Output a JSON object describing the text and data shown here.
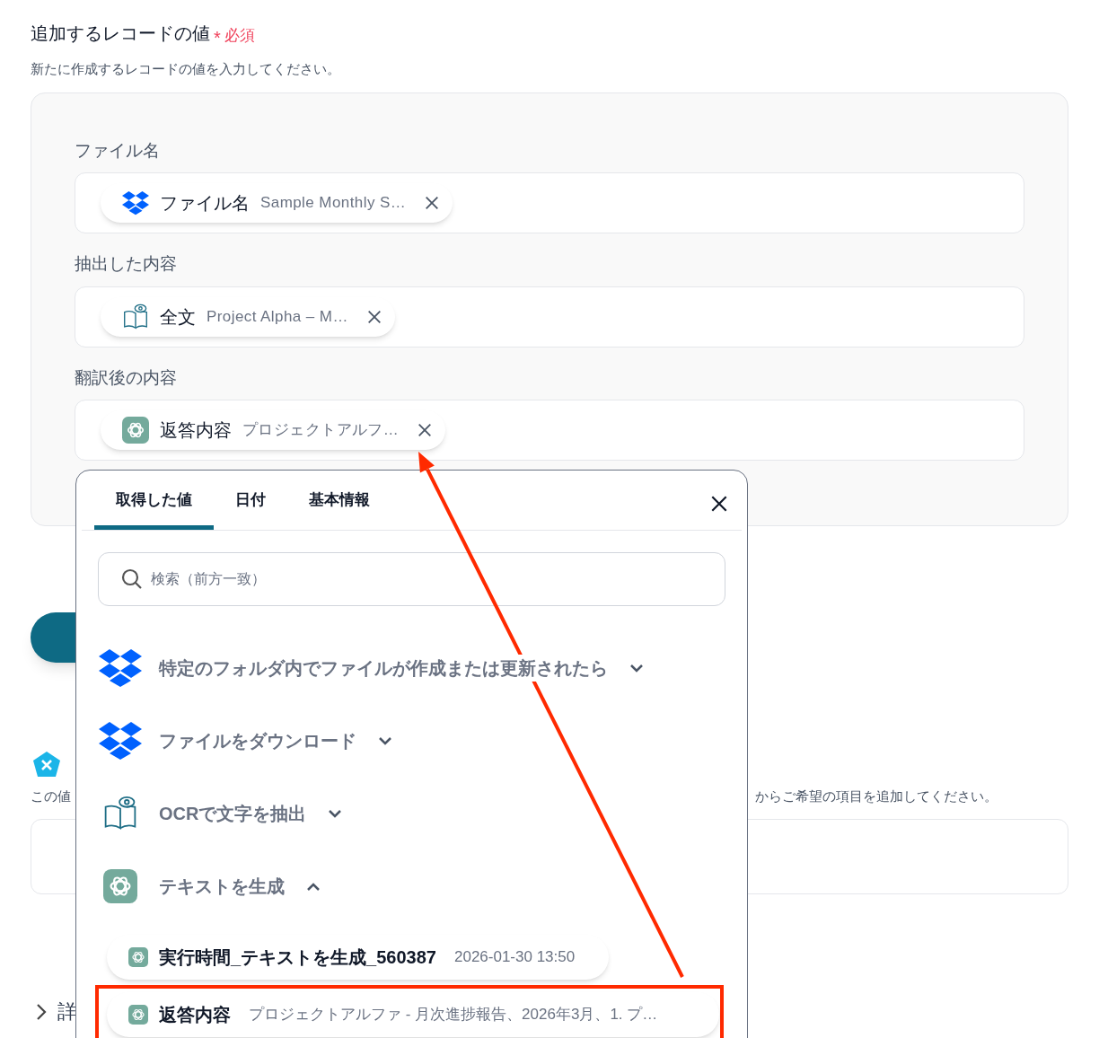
{
  "section": {
    "title": "追加するレコードの値",
    "required_mark": "*",
    "required_label": "必須",
    "description": "新たに作成するレコードの値を入力してください。",
    "fields": [
      {
        "label": "ファイル名",
        "chip": {
          "kind": "dropbox",
          "name": "ファイル名",
          "value": "Sample Monthly S…"
        }
      },
      {
        "label": "抽出した内容",
        "chip": {
          "kind": "ocr",
          "name": "全文",
          "value": "Project Alpha – M…"
        }
      },
      {
        "label": "翻訳後の内容",
        "chip": {
          "kind": "openai",
          "name": "返答内容",
          "value": "プロジェクトアルフ…"
        }
      }
    ]
  },
  "lower_section": {
    "description_start": "この値",
    "description_end": "からご希望の項目を追加してください。"
  },
  "details": {
    "label": "詳"
  },
  "popup": {
    "tabs": [
      {
        "label": "取得した値",
        "selected": true
      },
      {
        "label": "日付",
        "selected": false
      },
      {
        "label": "基本情報",
        "selected": false
      }
    ],
    "search": {
      "placeholder": "検索（前方一致）"
    },
    "groups": [
      {
        "kind": "dropbox",
        "label": "特定のフォルダ内でファイルが作成または更新されたら",
        "expanded": false
      },
      {
        "kind": "dropbox",
        "label": "ファイルをダウンロード",
        "expanded": false
      },
      {
        "kind": "ocr",
        "label": "OCRで文字を抽出",
        "expanded": false
      },
      {
        "kind": "openai",
        "label": "テキストを生成",
        "expanded": true,
        "items": [
          {
            "name": "実行時間_テキストを生成_560387",
            "value": "2026-01-30 13:50",
            "highlighted": false
          },
          {
            "name": "返答内容",
            "value": "プロジェクトアルファ - 月次進捗報告、2026年3月、1. プ…",
            "highlighted": true
          }
        ]
      }
    ]
  }
}
